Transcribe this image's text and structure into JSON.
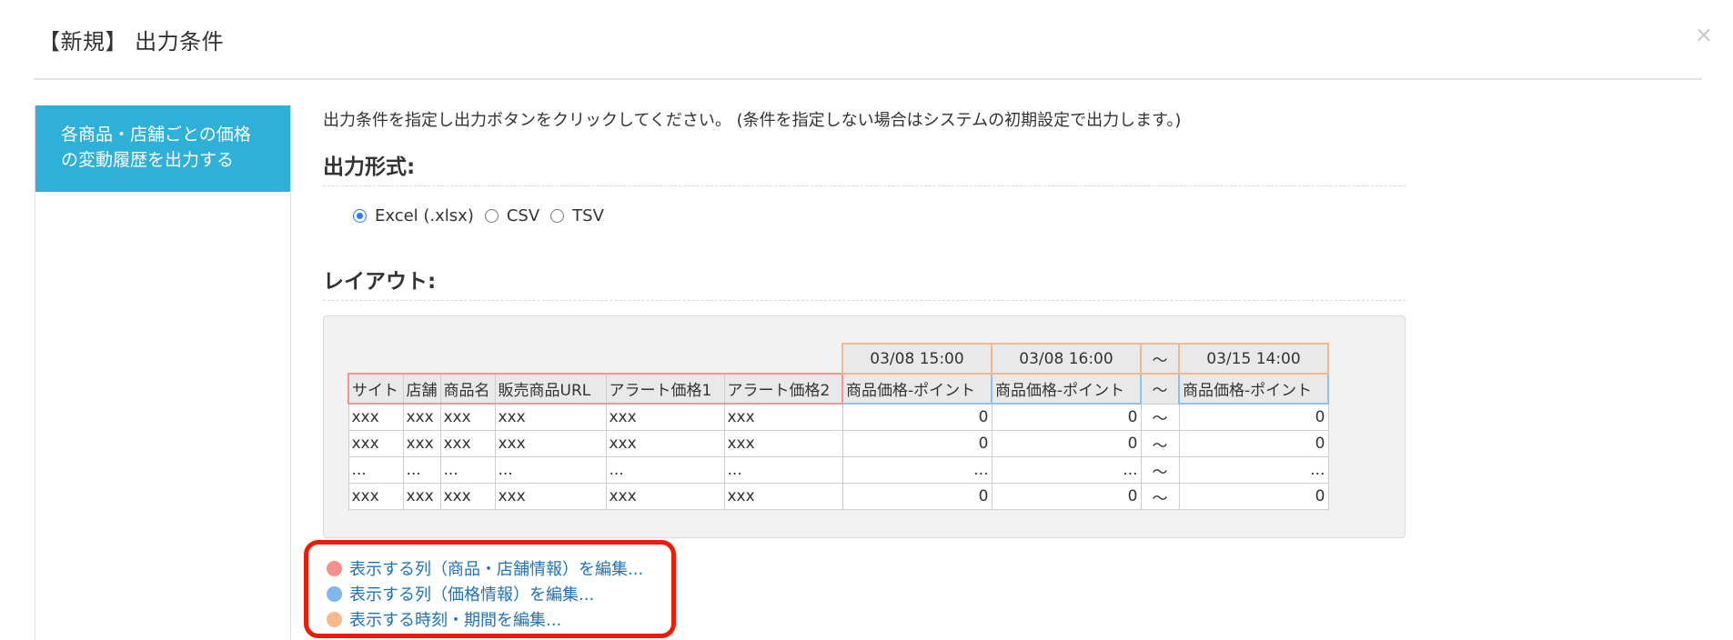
{
  "header": {
    "title": "【新規】 出力条件",
    "close_label": "×"
  },
  "sidebar": {
    "items": [
      {
        "label_line1": "各商品・店舗ごとの価格",
        "label_line2": "の変動履歴を出力する"
      }
    ]
  },
  "main": {
    "instruction": "出力条件を指定し出力ボタンをクリックしてください。 (条件を指定しない場合はシステムの初期設定で出力します。)",
    "format_title": "出力形式:",
    "format_options": [
      "Excel (.xlsx)",
      "CSV",
      "TSV"
    ],
    "format_selected": "Excel (.xlsx)",
    "layout_title": "レイアウト:"
  },
  "layout_table": {
    "dates": [
      "03/08 15:00",
      "03/08 16:00",
      "〜",
      "03/15 14:00"
    ],
    "headers": [
      "サイト",
      "店舗",
      "商品名",
      "販売商品URL",
      "アラート価格1",
      "アラート価格2",
      "商品価格-ポイント",
      "商品価格-ポイント",
      "〜",
      "商品価格-ポイント"
    ],
    "rows": [
      [
        "xxx",
        "xxx",
        "xxx",
        "xxx",
        "xxx",
        "xxx",
        "0",
        "0",
        "〜",
        "0"
      ],
      [
        "xxx",
        "xxx",
        "xxx",
        "xxx",
        "xxx",
        "xxx",
        "0",
        "0",
        "〜",
        "0"
      ],
      [
        "...",
        "...",
        "...",
        "...",
        "...",
        "...",
        "...",
        "...",
        "〜",
        "..."
      ],
      [
        "xxx",
        "xxx",
        "xxx",
        "xxx",
        "xxx",
        "xxx",
        "0",
        "0",
        "〜",
        "0"
      ]
    ]
  },
  "edit_links": [
    {
      "label": "表示する列（商品・店舗情報）を編集...",
      "color": "#f78f8f"
    },
    {
      "label": "表示する列（価格情報）を編集...",
      "color": "#7fb8ef"
    },
    {
      "label": "表示する時刻・期間を編集...",
      "color": "#f7b98a"
    }
  ],
  "colors": {
    "accent": "#2fb0d8",
    "highlight_border": "#ee1b07",
    "link": "#1f72b8"
  }
}
